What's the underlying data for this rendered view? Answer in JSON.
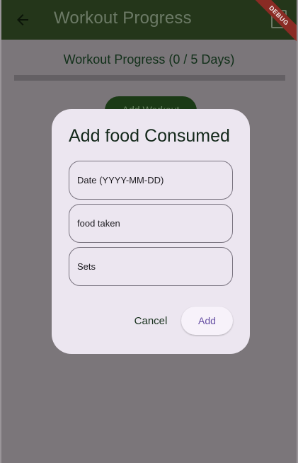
{
  "appbar": {
    "title": "Workout Progress",
    "back_icon": "arrow-back-icon",
    "trailing_icon": "document-icon",
    "debug_label": "DEBUG"
  },
  "progress": {
    "title": "Workout Progress (0 / 5 Days)",
    "completed": 0,
    "total": 5,
    "fraction": 0
  },
  "background_button": {
    "label": "Add Workout"
  },
  "dialog": {
    "title": "Add food Consumed",
    "fields": [
      {
        "placeholder": "Date (YYYY-MM-DD)",
        "value": ""
      },
      {
        "placeholder": "food taken",
        "value": ""
      },
      {
        "placeholder": "Sets",
        "value": ""
      }
    ],
    "cancel_label": "Cancel",
    "add_label": "Add"
  },
  "colors": {
    "scrim": "#7b767a",
    "appbar": "#24361a",
    "dialog_bg": "#ece6f0",
    "accent": "#6750a4"
  }
}
